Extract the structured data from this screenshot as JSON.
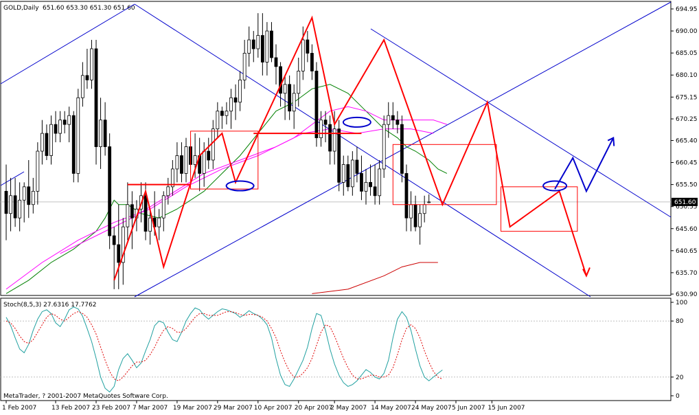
{
  "chart_data": {
    "type": "candlestick",
    "symbol_header": "GOLD,Daily",
    "ohlc_header": "651.60 653.30 651.30 651.60",
    "copyright": "MetaTrader, ? 2001-2007 MetaQuotes Software Corp.",
    "price_axis": {
      "ticks": [
        "694.95",
        "690.00",
        "685.05",
        "680.10",
        "675.15",
        "670.25",
        "665.40",
        "660.45",
        "655.50",
        "650.55",
        "645.60",
        "640.65",
        "635.70",
        "630.90"
      ],
      "ylim": [
        630.9,
        694.95
      ],
      "current_price_label": "651.60"
    },
    "date_axis": {
      "ticks": [
        "1 Feb 2007",
        "13 Feb 2007",
        "23 Feb 2007",
        "7 Mar 2007",
        "19 Mar 2007",
        "29 Mar 2007",
        "10 Apr 2007",
        "20 Apr 2007",
        "2 May 2007",
        "14 May 2007",
        "24 May 2007",
        "5 Jun 2007",
        "15 Jun 2007"
      ]
    },
    "candles": [
      {
        "o": 654,
        "h": 660,
        "l": 643,
        "c": 649
      },
      {
        "o": 649,
        "h": 657,
        "l": 645,
        "c": 653
      },
      {
        "o": 653,
        "h": 657,
        "l": 646,
        "c": 648
      },
      {
        "o": 648,
        "h": 656,
        "l": 645,
        "c": 652
      },
      {
        "o": 652,
        "h": 656,
        "l": 647,
        "c": 655
      },
      {
        "o": 655,
        "h": 661,
        "l": 648,
        "c": 651
      },
      {
        "o": 651,
        "h": 657,
        "l": 649,
        "c": 654
      },
      {
        "o": 654,
        "h": 665,
        "l": 651,
        "c": 663
      },
      {
        "o": 663,
        "h": 670,
        "l": 660,
        "c": 667
      },
      {
        "o": 667,
        "h": 669,
        "l": 661,
        "c": 662
      },
      {
        "o": 662,
        "h": 671,
        "l": 660,
        "c": 669
      },
      {
        "o": 669,
        "h": 672,
        "l": 665,
        "c": 667
      },
      {
        "o": 667,
        "h": 672,
        "l": 665,
        "c": 670
      },
      {
        "o": 670,
        "h": 672,
        "l": 667,
        "c": 669
      },
      {
        "o": 669,
        "h": 673,
        "l": 665,
        "c": 671
      },
      {
        "o": 671,
        "h": 672,
        "l": 656,
        "c": 658
      },
      {
        "o": 658,
        "h": 677,
        "l": 656,
        "c": 675
      },
      {
        "o": 675,
        "h": 683,
        "l": 673,
        "c": 680
      },
      {
        "o": 680,
        "h": 686,
        "l": 677,
        "c": 679
      },
      {
        "o": 679,
        "h": 688,
        "l": 677,
        "c": 686
      },
      {
        "o": 686,
        "h": 688,
        "l": 660,
        "c": 664
      },
      {
        "o": 664,
        "h": 675,
        "l": 659,
        "c": 670
      },
      {
        "o": 670,
        "h": 674,
        "l": 662,
        "c": 664
      },
      {
        "o": 664,
        "h": 667,
        "l": 641,
        "c": 644
      },
      {
        "o": 644,
        "h": 646,
        "l": 632,
        "c": 642
      },
      {
        "o": 642,
        "h": 651,
        "l": 632,
        "c": 638
      },
      {
        "o": 638,
        "h": 648,
        "l": 633,
        "c": 646
      },
      {
        "o": 646,
        "h": 656,
        "l": 643,
        "c": 651
      },
      {
        "o": 651,
        "h": 654,
        "l": 641,
        "c": 648
      },
      {
        "o": 648,
        "h": 652,
        "l": 645,
        "c": 650
      },
      {
        "o": 650,
        "h": 656,
        "l": 647,
        "c": 653
      },
      {
        "o": 653,
        "h": 656,
        "l": 643,
        "c": 645
      },
      {
        "o": 645,
        "h": 650,
        "l": 642,
        "c": 648
      },
      {
        "o": 648,
        "h": 654,
        "l": 644,
        "c": 646
      },
      {
        "o": 646,
        "h": 650,
        "l": 643,
        "c": 648
      },
      {
        "o": 648,
        "h": 654,
        "l": 645,
        "c": 653
      },
      {
        "o": 653,
        "h": 657,
        "l": 651,
        "c": 655
      },
      {
        "o": 655,
        "h": 661,
        "l": 653,
        "c": 659
      },
      {
        "o": 659,
        "h": 665,
        "l": 656,
        "c": 662
      },
      {
        "o": 662,
        "h": 665,
        "l": 656,
        "c": 658
      },
      {
        "o": 658,
        "h": 666,
        "l": 656,
        "c": 664
      },
      {
        "o": 664,
        "h": 666,
        "l": 658,
        "c": 660
      },
      {
        "o": 660,
        "h": 667,
        "l": 657,
        "c": 662
      },
      {
        "o": 662,
        "h": 666,
        "l": 654,
        "c": 658
      },
      {
        "o": 658,
        "h": 665,
        "l": 655,
        "c": 663
      },
      {
        "o": 663,
        "h": 666,
        "l": 659,
        "c": 661
      },
      {
        "o": 661,
        "h": 670,
        "l": 659,
        "c": 668
      },
      {
        "o": 668,
        "h": 674,
        "l": 666,
        "c": 672
      },
      {
        "o": 672,
        "h": 673,
        "l": 668,
        "c": 671
      },
      {
        "o": 671,
        "h": 674,
        "l": 669,
        "c": 672
      },
      {
        "o": 672,
        "h": 677,
        "l": 668,
        "c": 675
      },
      {
        "o": 675,
        "h": 678,
        "l": 670,
        "c": 674
      },
      {
        "o": 674,
        "h": 681,
        "l": 672,
        "c": 679
      },
      {
        "o": 679,
        "h": 688,
        "l": 677,
        "c": 685
      },
      {
        "o": 685,
        "h": 691,
        "l": 682,
        "c": 688
      },
      {
        "o": 688,
        "h": 690,
        "l": 683,
        "c": 686
      },
      {
        "o": 686,
        "h": 694,
        "l": 684,
        "c": 689
      },
      {
        "o": 689,
        "h": 694,
        "l": 680,
        "c": 683
      },
      {
        "o": 683,
        "h": 692,
        "l": 680,
        "c": 690
      },
      {
        "o": 690,
        "h": 692,
        "l": 683,
        "c": 684
      },
      {
        "o": 684,
        "h": 687,
        "l": 678,
        "c": 682
      },
      {
        "o": 682,
        "h": 683,
        "l": 673,
        "c": 676
      },
      {
        "o": 676,
        "h": 680,
        "l": 670,
        "c": 678
      },
      {
        "o": 678,
        "h": 680,
        "l": 670,
        "c": 672
      },
      {
        "o": 672,
        "h": 678,
        "l": 668,
        "c": 676
      },
      {
        "o": 676,
        "h": 684,
        "l": 673,
        "c": 681
      },
      {
        "o": 681,
        "h": 691,
        "l": 679,
        "c": 688
      },
      {
        "o": 688,
        "h": 690,
        "l": 683,
        "c": 685
      },
      {
        "o": 685,
        "h": 687,
        "l": 679,
        "c": 681
      },
      {
        "o": 681,
        "h": 683,
        "l": 664,
        "c": 666
      },
      {
        "o": 666,
        "h": 672,
        "l": 664,
        "c": 670
      },
      {
        "o": 670,
        "h": 672,
        "l": 665,
        "c": 669
      },
      {
        "o": 669,
        "h": 671,
        "l": 660,
        "c": 663
      },
      {
        "o": 663,
        "h": 672,
        "l": 660,
        "c": 668
      },
      {
        "o": 668,
        "h": 670,
        "l": 654,
        "c": 656
      },
      {
        "o": 656,
        "h": 662,
        "l": 653,
        "c": 660
      },
      {
        "o": 660,
        "h": 662,
        "l": 654,
        "c": 655
      },
      {
        "o": 655,
        "h": 663,
        "l": 653,
        "c": 661
      },
      {
        "o": 661,
        "h": 664,
        "l": 656,
        "c": 658
      },
      {
        "o": 658,
        "h": 662,
        "l": 652,
        "c": 654
      },
      {
        "o": 654,
        "h": 659,
        "l": 651,
        "c": 656
      },
      {
        "o": 656,
        "h": 660,
        "l": 653,
        "c": 655
      },
      {
        "o": 655,
        "h": 660,
        "l": 651,
        "c": 653
      },
      {
        "o": 653,
        "h": 661,
        "l": 651,
        "c": 659
      },
      {
        "o": 659,
        "h": 671,
        "l": 657,
        "c": 669
      },
      {
        "o": 669,
        "h": 674,
        "l": 666,
        "c": 671
      },
      {
        "o": 671,
        "h": 674,
        "l": 668,
        "c": 670
      },
      {
        "o": 670,
        "h": 672,
        "l": 667,
        "c": 669
      },
      {
        "o": 669,
        "h": 671,
        "l": 656,
        "c": 658
      },
      {
        "o": 658,
        "h": 660,
        "l": 645,
        "c": 648
      },
      {
        "o": 648,
        "h": 654,
        "l": 645,
        "c": 651
      },
      {
        "o": 651,
        "h": 653,
        "l": 645,
        "c": 646
      },
      {
        "o": 646,
        "h": 651,
        "l": 642,
        "c": 649
      },
      {
        "o": 649,
        "h": 653,
        "l": 647,
        "c": 651
      },
      {
        "o": 651.6,
        "h": 653.3,
        "l": 651.3,
        "c": 651.6
      }
    ],
    "series": [
      {
        "name": "",
        "color": "#008000",
        "values": [
          [
            0,
            631
          ],
          [
            5,
            634
          ],
          [
            10,
            638
          ],
          [
            15,
            641
          ],
          [
            20,
            645
          ],
          [
            22,
            648
          ],
          [
            24,
            652
          ],
          [
            25,
            651
          ],
          [
            27,
            651
          ],
          [
            30,
            649
          ],
          [
            34,
            648
          ],
          [
            38,
            650
          ],
          [
            44,
            654
          ],
          [
            48,
            658
          ],
          [
            52,
            662
          ],
          [
            56,
            667
          ],
          [
            60,
            672
          ],
          [
            64,
            674
          ],
          [
            68,
            677
          ],
          [
            72,
            678
          ],
          [
            76,
            676
          ],
          [
            80,
            672
          ],
          [
            84,
            668
          ],
          [
            87,
            666
          ],
          [
            89,
            664
          ],
          [
            91,
            663
          ],
          [
            94,
            661
          ],
          [
            96,
            659
          ],
          [
            98,
            658
          ]
        ]
      },
      {
        "name": "",
        "color": "#ff00ff",
        "values": [
          [
            0,
            632
          ],
          [
            8,
            638
          ],
          [
            16,
            643
          ],
          [
            24,
            647
          ],
          [
            32,
            650
          ],
          [
            40,
            655
          ],
          [
            48,
            659
          ],
          [
            56,
            662
          ],
          [
            60,
            664
          ],
          [
            64,
            666
          ],
          [
            68,
            669
          ],
          [
            72,
            672
          ],
          [
            76,
            673
          ],
          [
            80,
            672
          ],
          [
            84,
            670
          ],
          [
            88,
            670
          ],
          [
            92,
            670
          ],
          [
            95,
            670
          ],
          [
            98,
            669
          ]
        ]
      },
      {
        "name": "",
        "color": "#ff00ff",
        "values": [
          [
            12,
            640
          ],
          [
            20,
            644
          ],
          [
            28,
            648
          ],
          [
            36,
            653
          ],
          [
            44,
            658
          ],
          [
            52,
            661
          ],
          [
            60,
            664
          ],
          [
            66,
            667
          ],
          [
            72,
            668
          ],
          [
            78,
            667
          ],
          [
            84,
            668
          ],
          [
            90,
            668
          ],
          [
            95,
            667
          ]
        ]
      },
      {
        "name": "",
        "color": "#cc0000",
        "values": [
          [
            68,
            631
          ],
          [
            76,
            632
          ],
          [
            84,
            635
          ],
          [
            88,
            637
          ],
          [
            92,
            638
          ],
          [
            96,
            638
          ]
        ]
      }
    ],
    "stochastic": {
      "label": "Stoch(8,5,3) 27.6316 17.7762",
      "ticks": [
        "100",
        "80",
        "20",
        "0"
      ],
      "main": [
        84,
        75,
        62,
        50,
        46,
        55,
        70,
        82,
        90,
        92,
        88,
        78,
        74,
        82,
        92,
        95,
        93,
        85,
        72,
        58,
        40,
        20,
        8,
        4,
        10,
        28,
        40,
        45,
        38,
        30,
        35,
        48,
        60,
        75,
        80,
        78,
        68,
        60,
        58,
        68,
        80,
        88,
        94,
        92,
        86,
        82,
        86,
        90,
        93,
        92,
        90,
        88,
        84,
        87,
        91,
        88,
        86,
        82,
        76,
        62,
        40,
        22,
        12,
        10,
        18,
        28,
        38,
        52,
        72,
        88,
        86,
        70,
        50,
        34,
        22,
        14,
        10,
        12,
        16,
        22,
        28,
        25,
        20,
        18,
        24,
        38,
        62,
        82,
        90,
        84,
        70,
        50,
        32,
        20,
        16,
        20,
        24,
        27.6
      ],
      "signal": [
        80,
        78,
        72,
        64,
        58,
        56,
        60,
        68,
        76,
        84,
        88,
        86,
        82,
        80,
        84,
        88,
        90,
        88,
        84,
        76,
        66,
        52,
        38,
        26,
        18,
        16,
        20,
        26,
        32,
        36,
        36,
        38,
        44,
        52,
        62,
        70,
        74,
        72,
        68,
        68,
        72,
        78,
        84,
        88,
        88,
        86,
        86,
        86,
        88,
        90,
        90,
        89,
        87,
        86,
        87,
        87,
        86,
        84,
        80,
        72,
        62,
        48,
        36,
        26,
        20,
        20,
        24,
        30,
        40,
        54,
        68,
        76,
        74,
        64,
        52,
        40,
        30,
        22,
        18,
        18,
        20,
        22,
        22,
        20,
        20,
        22,
        30,
        44,
        60,
        72,
        76,
        72,
        62,
        48,
        36,
        26,
        20,
        17.8
      ]
    },
    "annotations": {
      "colors": {
        "trend": "#0000cc",
        "pattern": "#ff0000",
        "grid": "#c0c0c0",
        "bullish_candle": "#ffffff",
        "bearish_candle": "#000000"
      }
    }
  }
}
